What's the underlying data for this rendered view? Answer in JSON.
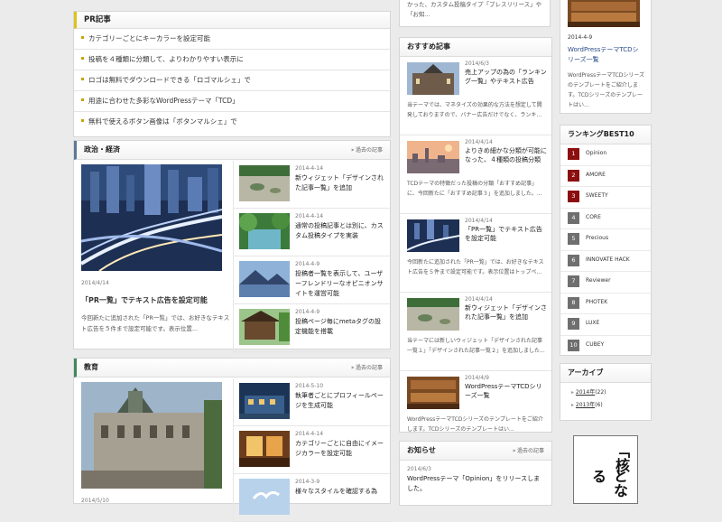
{
  "pr": {
    "title": "PR記事",
    "items": [
      "カテゴリーごとにキーカラーを設定可能",
      "投稿を４種類に分類して、よりわかりやすい表示に",
      "ロゴは無料でダウンロードできる「ロゴマルシェ」で",
      "用途に合わせた多彩なWordPressテーマ「TCD」",
      "無料で使えるボタン画像は「ボタンマルシェ」で"
    ]
  },
  "cat1": {
    "title": "政治・経済",
    "more": "過去の記事",
    "feature": {
      "date": "2014/4/14",
      "title": "「PR一覧」でテキスト広告を設定可能",
      "excerpt": "今回新たに追加された「PR一覧」では、お好きなテキスト広告を５件まで設定可能です。表示位置..."
    },
    "items": [
      {
        "date": "2014-4-14",
        "title": "新ウィジェット「デザインされた記事一覧」を追加"
      },
      {
        "date": "2014-4-14",
        "title": "通常の投稿記事とは別に、カスタム投稿タイプを実装"
      },
      {
        "date": "2014-4-9",
        "title": "投稿者一覧を表示して、ユーザーフレンドリーなオピニオンサイトを運営可能"
      },
      {
        "date": "2014-4-9",
        "title": "投稿ページ毎にmetaタグの設定機能を搭載"
      }
    ]
  },
  "cat2": {
    "title": "教育",
    "more": "過去の記事",
    "feature": {
      "date": "2014/5/10"
    },
    "items": [
      {
        "date": "2014-5-10",
        "title": "執筆者ごとにプロフィールページを生成可能"
      },
      {
        "date": "2014-4-14",
        "title": "カテゴリーごとに自由にイメージカラーを設定可能"
      },
      {
        "date": "2014-3-9",
        "title": "様々なスタイルを確認する為"
      }
    ]
  },
  "mid": {
    "top_text": "かった、カスタム投稿タイプ「プレスリリース」や「お知...",
    "rec_title": "おすすめ記事",
    "rec_items": [
      {
        "date": "2014/6/3",
        "title": "売上アップの為の「ランキング一覧」やテキスト広告",
        "excerpt": "当テーマでは、マネタイズの効果的な方法を想定して開発しておりますので、バナー広告だけでなく、ランキ..."
      },
      {
        "date": "2014/4/14",
        "title": "よりきめ細かな分類が可能になった、４種類の投稿分類",
        "excerpt": "TCDテーマの特徴だった投稿の分類「おすすめ記事」に、今回新たに「おすすめ記事３」を追加しました。..."
      },
      {
        "date": "2014/4/14",
        "title": "「PR一覧」でテキスト広告を設定可能",
        "excerpt": "今回新たに追加された「PR一覧」では、お好きなテキスト広告を５件まで設定可能です。表示位置はトップペ..."
      },
      {
        "date": "2014/4/14",
        "title": "新ウィジェット「デザインされた記事一覧」を追加",
        "excerpt": "当テーマには新しいウィジェット「デザインされた記事一覧１」「デザインされた記事一覧２」を追加しました..."
      },
      {
        "date": "2014/4/9",
        "title": "WordPressテーマTCDシリーズ一覧",
        "excerpt": "WordPressテーマTCDシリーズのテンプレートをご紹介します。TCDシリーズのテンプレートはい..."
      }
    ],
    "news_title": "お知らせ",
    "news_more": "過去の記事",
    "news_date": "2014/6/3",
    "news_text": "WordPressテーマ「Opinion」をリリースしました。"
  },
  "right": {
    "top": {
      "date": "2014-4-9",
      "title": "WordPressテーマTCDシリーズ一覧",
      "excerpt": "WordPressテーマTCDシリーズのテンプレートをご紹介します。TCDシリーズのテンプレートはい..."
    },
    "rank_title": "ランキングBEST10",
    "ranks": [
      {
        "n": "1",
        "name": "Opinion"
      },
      {
        "n": "2",
        "name": "AMORE"
      },
      {
        "n": "3",
        "name": "SWEETY"
      },
      {
        "n": "4",
        "name": "CORE"
      },
      {
        "n": "5",
        "name": "Precious"
      },
      {
        "n": "6",
        "name": "INNOVATE HACK"
      },
      {
        "n": "7",
        "name": "Reviewer"
      },
      {
        "n": "8",
        "name": "PHOTEK"
      },
      {
        "n": "9",
        "name": "LUXE"
      },
      {
        "n": "10",
        "name": "CUBEY"
      }
    ],
    "archive_title": "アーカイブ",
    "archives": [
      {
        "label": "2014年",
        "count": "(22)"
      },
      {
        "label": "2013年",
        "count": "(6)"
      }
    ],
    "ad_line1": "「核",
    "ad_line2": "となる"
  },
  "colors": {
    "accent_gold": "#c7a300",
    "rank_top": "#8c0f0f",
    "politics": "#5c7894",
    "education": "#3c8a5a"
  }
}
